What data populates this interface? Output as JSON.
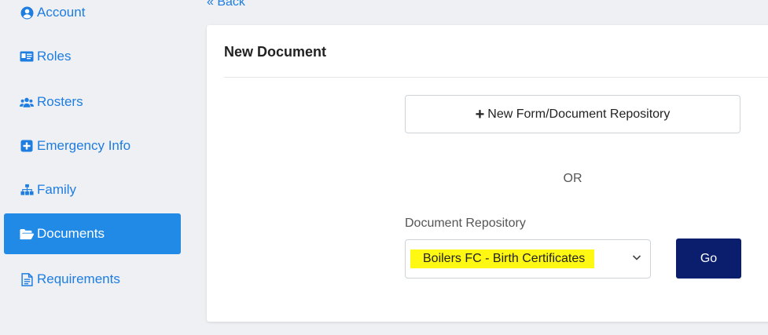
{
  "sidebar": {
    "items": [
      {
        "label": "Account",
        "icon": "user-circle-icon"
      },
      {
        "label": "Roles",
        "icon": "id-card-icon"
      },
      {
        "label": "Rosters",
        "icon": "users-icon"
      },
      {
        "label": "Emergency Info",
        "icon": "plus-square-icon"
      },
      {
        "label": "Family",
        "icon": "sitemap-icon"
      },
      {
        "label": "Documents",
        "icon": "folder-open-icon",
        "active": true
      },
      {
        "label": "Requirements",
        "icon": "file-text-icon"
      }
    ]
  },
  "back_label": "« Back",
  "card": {
    "title": "New Document",
    "new_repo_button": "New Form/Document Repository",
    "or_text": "OR",
    "repo_label": "Document Repository",
    "repo_selected": "Boilers FC - Birth Certificates",
    "go_label": "Go"
  },
  "colors": {
    "accent": "#1e7de0",
    "active_bg": "#2189e6",
    "go_bg": "#0b1e6e",
    "highlight": "#fff812"
  }
}
